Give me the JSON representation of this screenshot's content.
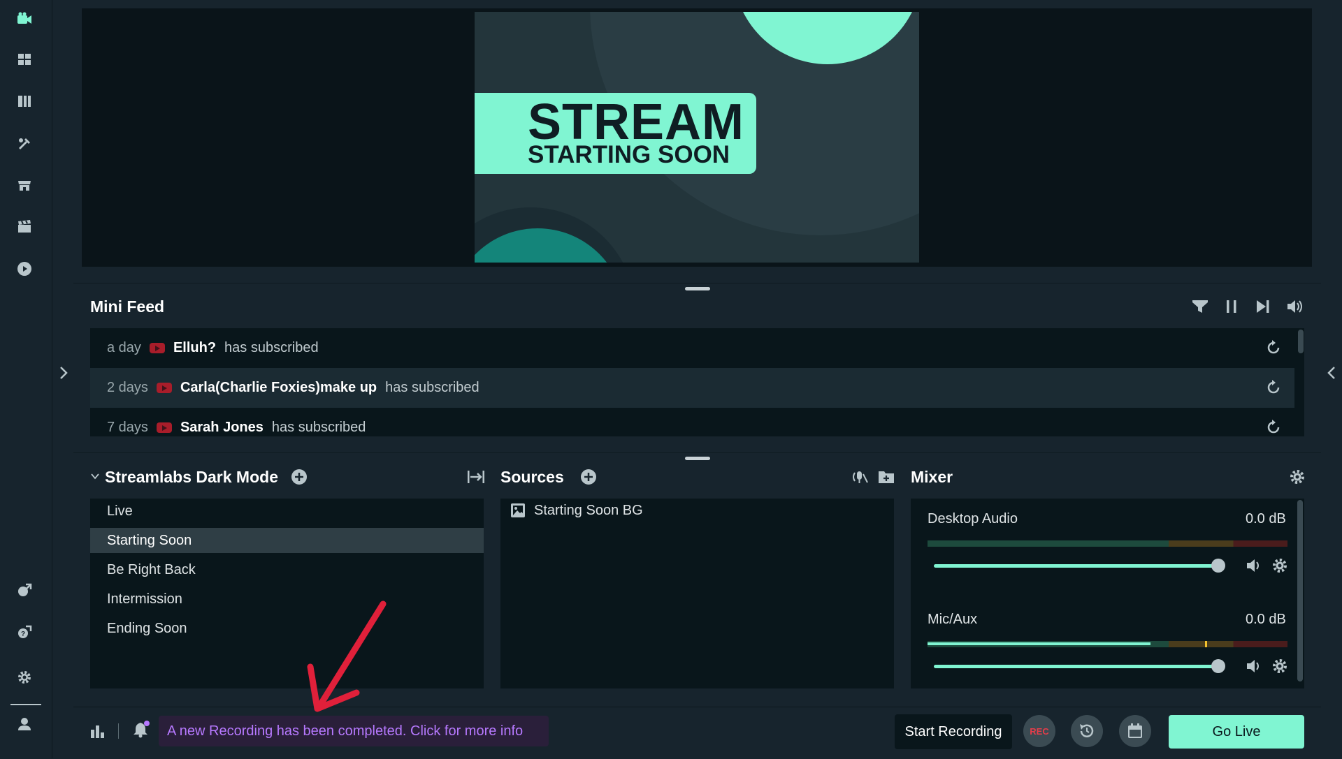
{
  "colors": {
    "accent": "#80f5d2",
    "background": "#17242d",
    "panel": "#09161b",
    "notification": "#b779ff",
    "rec": "#e53d4a",
    "arrow": "#e0203a"
  },
  "nav": {
    "icons": [
      "editor-icon",
      "layout-icon",
      "studio-mode-icon",
      "themes-icon",
      "app-store-icon",
      "highlighter-icon",
      "cloud-play-icon",
      "remote-control-icon",
      "help-icon",
      "settings-icon",
      "user-icon"
    ]
  },
  "preview": {
    "line1": "STREAM",
    "line2": "STARTING SOON"
  },
  "mini_feed": {
    "title": "Mini Feed",
    "items": [
      {
        "time": "a day",
        "name": "Elluh?",
        "message": "has subscribed"
      },
      {
        "time": "2 days",
        "name": "Carla(Charlie Foxies)make up",
        "message": "has subscribed"
      },
      {
        "time": "7 days",
        "name": "Sarah Jones",
        "message": "has subscribed"
      }
    ]
  },
  "scenes": {
    "collection": "Streamlabs Dark Mode",
    "items": [
      "Live",
      "Starting Soon",
      "Be Right Back",
      "Intermission",
      "Ending Soon"
    ],
    "selected": "Starting Soon"
  },
  "sources": {
    "title": "Sources",
    "items": [
      "Starting Soon BG"
    ]
  },
  "mixer": {
    "title": "Mixer",
    "channels": [
      {
        "name": "Desktop Audio",
        "db": "0.0 dB",
        "volume": 1.0,
        "level": 0.0
      },
      {
        "name": "Mic/Aux",
        "db": "0.0 dB",
        "volume": 1.0,
        "level": 0.62
      }
    ]
  },
  "footer": {
    "notification": "A new Recording has been completed. Click for more info",
    "start_recording": "Start Recording",
    "rec_label": "REC",
    "go_live": "Go Live"
  }
}
